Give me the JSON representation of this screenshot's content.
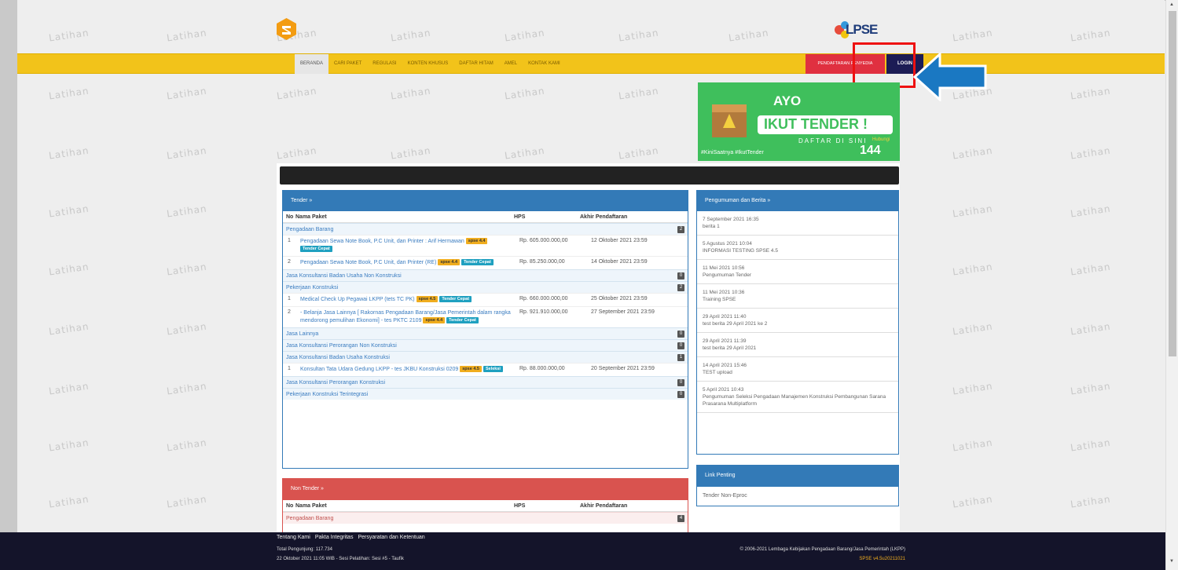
{
  "watermark_text": "Latihan",
  "nav": {
    "items": [
      "BERANDA",
      "CARI PAKET",
      "REGULASI",
      "KONTEN KHUSUS",
      "DAFTAR HITAM",
      "AMEL",
      "KONTAK KAMI"
    ],
    "register": "PENDAFTARAN PENYEDIA",
    "login": "LOGIN"
  },
  "logo": {
    "lpse": "LPSE"
  },
  "banner": {
    "line1": "AYO",
    "line2": "IKUT TENDER !",
    "line3": "DAFTAR DI SINI",
    "hashtags": "#KiniSaatnya #IkutTender",
    "phone_label": "Hubungi",
    "phone": "144"
  },
  "tender": {
    "title": "Tender »",
    "headers": {
      "no": "No",
      "nama": "Nama Paket",
      "hps": "HPS",
      "akhir": "Akhir Pendaftaran"
    },
    "groups": [
      {
        "name": "Pengadaan Barang",
        "count": "2",
        "rows": [
          {
            "no": "1",
            "nama": "Pengadaan Sewa Note Book, P.C Unit, dan Printer : Arif Hermawan",
            "tags": [
              "spse 4.4",
              "Tender Cepat"
            ],
            "hps": "Rp. 605.000.000,00",
            "akhir": "12 Oktober 2021 23:59"
          },
          {
            "no": "2",
            "nama": "Pengadaan Sewa Note Book, P.C Unit, dan Printer (RE)",
            "tags": [
              "spse 4.4",
              "Tender Cepat"
            ],
            "hps": "Rp. 85.250.000,00",
            "akhir": "14 Oktober 2021 23:59"
          }
        ]
      },
      {
        "name": "Jasa Konsultansi Badan Usaha Non Konstruksi",
        "count": "0",
        "rows": []
      },
      {
        "name": "Pekerjaan Konstruksi",
        "count": "2",
        "rows": [
          {
            "no": "1",
            "nama": "Medical Check Up Pegawai LKPP (tets TC PK)",
            "tags": [
              "spse 4.5",
              "Tender Cepat"
            ],
            "hps": "Rp. 660.000.000,00",
            "akhir": "25 Oktober 2021 23:59"
          },
          {
            "no": "2",
            "nama": "- Belanja Jasa Lainnya [ Rakornas Pengadaan Barang/Jasa Pemerintah dalam rangka mendorong pemulihan Ekonomi] - tes PKTC 2109",
            "tags": [
              "spse 4.4",
              "Tender Cepat"
            ],
            "hps": "Rp. 921.910.000,00",
            "akhir": "27 September 2021 23:59"
          }
        ]
      },
      {
        "name": "Jasa Lainnya",
        "count": "0",
        "rows": []
      },
      {
        "name": "Jasa Konsultansi Perorangan Non Konstruksi",
        "count": "0",
        "rows": []
      },
      {
        "name": "Jasa Konsultansi Badan Usaha Konstruksi",
        "count": "1",
        "rows": [
          {
            "no": "1",
            "nama": "Konsultan Tata Udara Gedung LKPP - tes JKBU Konstruksi 0209",
            "tags": [
              "spse 4.5",
              "Seleksi"
            ],
            "hps": "Rp. 88.000.000,00",
            "akhir": "20 September 2021 23:59"
          }
        ]
      },
      {
        "name": "Jasa Konsultansi Perorangan Konstruksi",
        "count": "0",
        "rows": []
      },
      {
        "name": "Pekerjaan Konstruksi Terintegrasi",
        "count": "0",
        "rows": []
      }
    ]
  },
  "nontender": {
    "title": "Non Tender »",
    "headers": {
      "no": "No",
      "nama": "Nama Paket",
      "hps": "HPS",
      "akhir": "Akhir Pendaftaran"
    },
    "first_group": "Pengadaan Barang",
    "first_count": "4"
  },
  "news": {
    "title": "Pengumuman dan Berita »",
    "items": [
      {
        "date": "7 September 2021 16:35",
        "text": "berita 1"
      },
      {
        "date": "5 Agustus 2021 10:04",
        "text": "INFORMASI TESTING SPSE 4.5"
      },
      {
        "date": "11 Mei 2021 10:56",
        "text": "Pengumuman Tender"
      },
      {
        "date": "11 Mei 2021 10:36",
        "text": "Training SPSE"
      },
      {
        "date": "29 April 2021 11:40",
        "text": "test berita 29 April 2021 ke 2"
      },
      {
        "date": "29 April 2021 11:39",
        "text": "test berita 29 April 2021"
      },
      {
        "date": "14 April 2021 15:46",
        "text": "TEST upload"
      },
      {
        "date": "5 April 2021 10:43",
        "text": "Pengumuman Seleksi Pengadaan Manajemen Konstruksi Pembangunan Sarana Prasarana Multiplatform"
      }
    ]
  },
  "links": {
    "title": "Link Penting",
    "items": [
      "Tender Non-Eproc"
    ]
  },
  "footer": {
    "links": [
      "Tentang Kami",
      "Pakta Integritas",
      "Persyaratan dan Ketentuan"
    ],
    "visitors": "Total Pengunjung: 117.734",
    "datetime": "22 Oktober 2021 11:05 WIB - Sesi Pelatihan: Sesi #5 - Taufik",
    "copyright": "© 2006-2021 Lembaga Kebijakan Pengadaan Barang/Jasa Pemerintah (LKPP)",
    "version": "SPSE v4.5u20211021"
  },
  "colors": {
    "nav": "#f2c31a",
    "primary": "#337ab7",
    "danger": "#d9534f",
    "login": "#1c1c55",
    "footer": "#14142a"
  }
}
